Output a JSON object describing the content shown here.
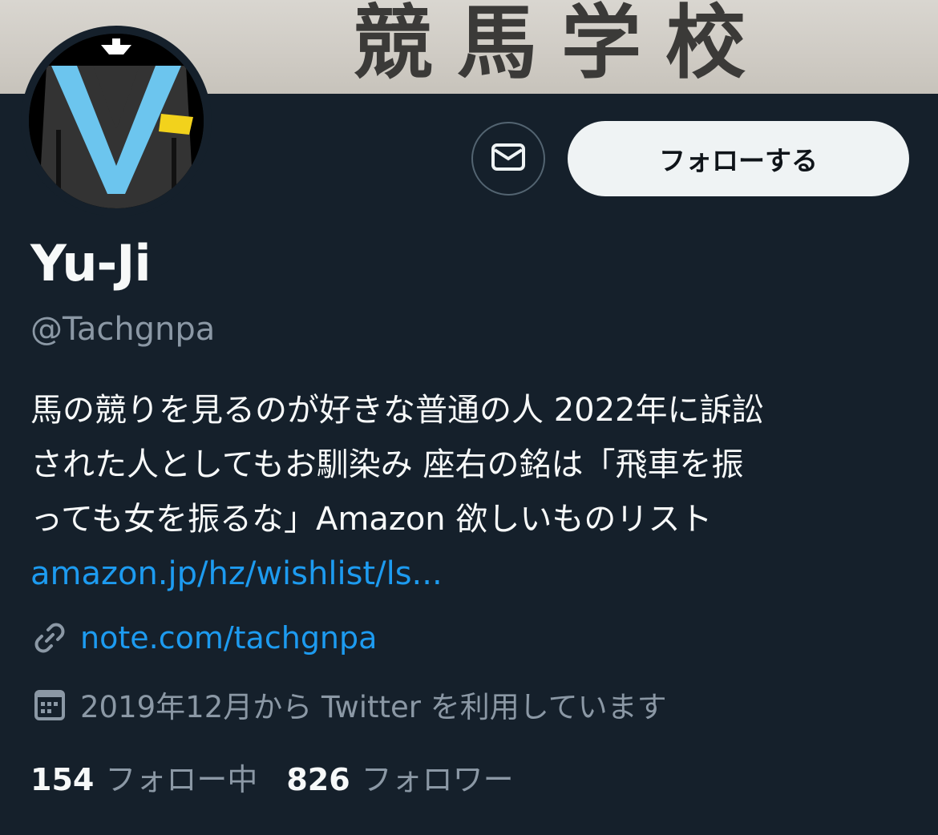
{
  "banner": {
    "text": "競馬学校"
  },
  "profile": {
    "name": "Yu-Ji",
    "handle": "@Tachgnpa",
    "bio_line1": "馬の競りを見るのが好きな普通の人 2022年に訴訟",
    "bio_line2": "された人としてもお馴染み 座右の銘は「飛車を振",
    "bio_line3": "っても女を振るな」Amazon 欲しいものリスト",
    "bio_link": "amazon.jp/hz/wishlist/ls...",
    "url": "note.com/tachgnpa",
    "joined": "2019年12月から Twitter を利用しています"
  },
  "actions": {
    "follow_label": "フォローする"
  },
  "stats": {
    "following_count": "154",
    "following_label": "フォロー中",
    "followers_count": "826",
    "followers_label": "フォロワー"
  },
  "icons": {
    "message": "envelope-icon",
    "link": "link-icon",
    "joined": "calendar-icon"
  },
  "colors": {
    "background": "#15202b",
    "link": "#1d9bf0",
    "secondary_text": "#8b98a5",
    "button_bg": "#eff3f4"
  }
}
